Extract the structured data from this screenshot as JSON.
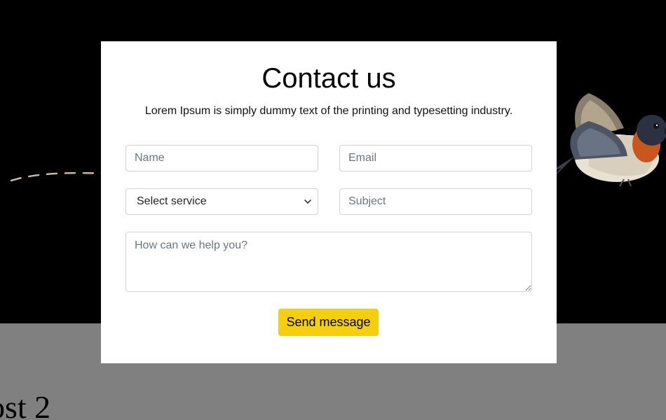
{
  "background": {
    "post_heading": "ost 2",
    "hero_color": "#000000",
    "lower_color": "#808080",
    "decoration_icon": "swallow-bird-illustration"
  },
  "modal": {
    "title": "Contact us",
    "subtitle": "Lorem Ipsum is simply dummy text of the printing and typesetting industry.",
    "fields": {
      "name_placeholder": "Name",
      "email_placeholder": "Email",
      "service_selected": "Select service",
      "subject_placeholder": "Subject",
      "message_placeholder": "How can we help you?"
    },
    "send_label": "Send message",
    "accent_color": "#f5cf0d"
  }
}
